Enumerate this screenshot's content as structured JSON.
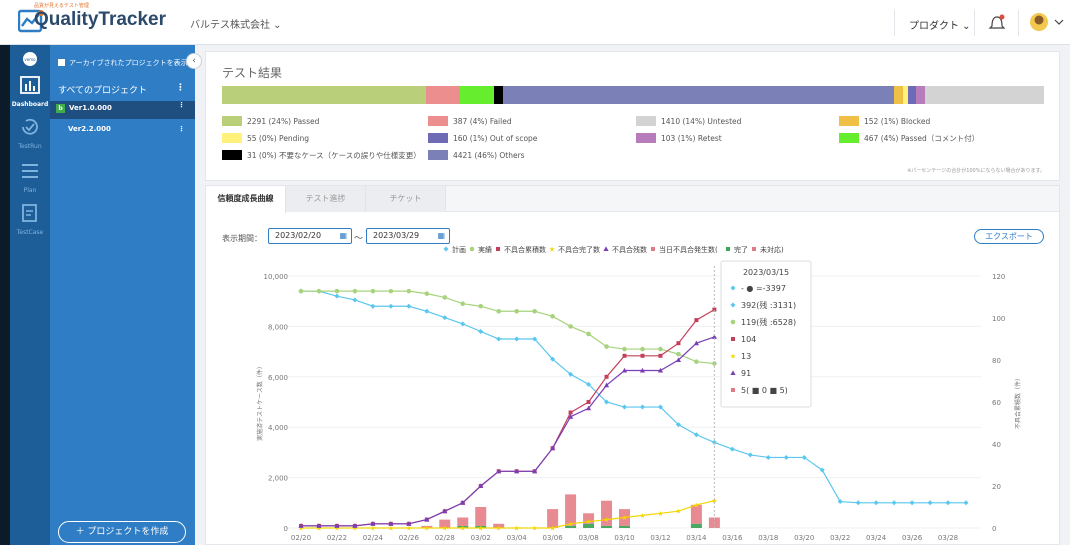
{
  "header": {
    "logo_tagline": "品質が見えるテスト管理",
    "logo_text": "QualityTracker",
    "company": "バルテス株式会社 ⌄",
    "product_menu": "プロダクト ⌄"
  },
  "rail": {
    "items": [
      {
        "label": "Dashboard",
        "icon": "bar-chart-icon",
        "active": true
      },
      {
        "label": "TestRun",
        "icon": "refresh-check-icon",
        "active": false
      },
      {
        "label": "Plan",
        "icon": "list-icon",
        "active": false
      },
      {
        "label": "TestCase",
        "icon": "edit-doc-icon",
        "active": false
      }
    ]
  },
  "sidebar": {
    "archive_toggle": "アーカイブされたプロジェクトを表示",
    "all_projects": "すべてのプロジェクト",
    "projects": [
      {
        "badge": "b",
        "name": "Ver1.0.000",
        "selected": true
      },
      {
        "name": "Ver2.2.000",
        "selected": false
      }
    ],
    "create_button": "＋ プロジェクトを作成"
  },
  "results": {
    "title": "テスト結果",
    "segments": [
      {
        "color": "#b9cf7a",
        "pct": 24
      },
      {
        "color": "#ec8e8e",
        "pct": 4
      },
      {
        "color": "#66ee2e",
        "pct": 4
      },
      {
        "color": "#000000",
        "pct": 1
      },
      {
        "color": "#7b80b7",
        "pct": 46
      },
      {
        "color": "#f0bf45",
        "pct": 1
      },
      {
        "color": "#fff17a",
        "pct": 0.6
      },
      {
        "color": "#6e6ab5",
        "pct": 1
      },
      {
        "color": "#b77cbc",
        "pct": 1
      },
      {
        "color": "#d3d3d3",
        "pct": 14
      }
    ],
    "legend": [
      {
        "label": "2291 (24%) Passed",
        "color": "#b9cf7a"
      },
      {
        "label": "387 (4%) Failed",
        "color": "#ec8e8e"
      },
      {
        "label": "1410 (14%) Untested",
        "color": "#d3d3d3"
      },
      {
        "label": "152 (1%) Blocked",
        "color": "#f0bf45"
      },
      {
        "label": "55 (0%) Pending",
        "color": "#fff17a"
      },
      {
        "label": "160 (1%) Out of scope",
        "color": "#6e6ab5"
      },
      {
        "label": "103 (1%) Retest",
        "color": "#b77cbc"
      },
      {
        "label": "467 (4%) Passed（コメント付）",
        "color": "#66ee2e"
      },
      {
        "label": "31 (0%) 不要なケース（ケースの誤りや仕様変更）",
        "color": "#000000"
      },
      {
        "label": "4421 (46%) Others",
        "color": "#7b80b7"
      }
    ],
    "note": "※パーセンテージの合計が100%にならない場合があります。"
  },
  "chart_panel": {
    "tabs": [
      "信頼度成長曲線",
      "テスト進捗",
      "チケット"
    ],
    "period_label": "表示期間：",
    "date_from": "2023/02/20",
    "date_to": "2023/03/29",
    "tilde": "～",
    "export_button": "エクスポート"
  },
  "chart_data": {
    "type": "line",
    "x": [
      "02/20",
      "02/21",
      "02/22",
      "02/23",
      "02/24",
      "02/25",
      "02/26",
      "02/27",
      "02/28",
      "03/01",
      "03/02",
      "03/03",
      "03/04",
      "03/05",
      "03/06",
      "03/07",
      "03/08",
      "03/09",
      "03/10",
      "03/11",
      "03/12",
      "03/13",
      "03/14",
      "03/15",
      "03/16",
      "03/17",
      "03/18",
      "03/19",
      "03/20",
      "03/21",
      "03/22",
      "03/23",
      "03/24",
      "03/25",
      "03/26",
      "03/27",
      "03/28",
      "03/29"
    ],
    "xticks": [
      "02/20",
      "02/22",
      "02/24",
      "02/26",
      "02/28",
      "03/02",
      "03/04",
      "03/06",
      "03/08",
      "03/10",
      "03/12",
      "03/14",
      "03/16",
      "03/18",
      "03/20",
      "03/22",
      "03/24",
      "03/26",
      "03/28"
    ],
    "ylabel_left": "実施済テストケース数（件）",
    "ylabel_right": "不具合累積数（件）",
    "ylim_left": [
      0,
      10000
    ],
    "ylim_right": [
      0,
      120
    ],
    "yticks_left": [
      "0",
      "2,000",
      "4,000",
      "6,000",
      "8,000",
      "10,000"
    ],
    "yticks_right": [
      "0",
      "20",
      "40",
      "60",
      "80",
      "100",
      "120"
    ],
    "legend": [
      {
        "name": "計画",
        "color": "#5bc6ee",
        "marker": "diamond"
      },
      {
        "name": "実績",
        "color": "#a8d37d",
        "marker": "circle"
      },
      {
        "name": "不具合累積数",
        "color": "#c4405a",
        "marker": "square"
      },
      {
        "name": "不具合完了数",
        "color": "#f2d600",
        "marker": "star"
      },
      {
        "name": "不具合残数",
        "color": "#7a3fb5",
        "marker": "triangle"
      },
      {
        "name": "当日不具合発生数(",
        "color": "#e07b86",
        "marker": "square"
      },
      {
        "name": "完了",
        "color": "#3aa65a",
        "marker": "square"
      },
      {
        "name": "未対応)",
        "color": "#e07b86",
        "marker": "square"
      }
    ],
    "series": [
      {
        "name": "計画",
        "axis": "left",
        "values": [
          9400,
          9400,
          9200,
          9050,
          8800,
          8800,
          8800,
          8600,
          8350,
          8100,
          7800,
          7500,
          7500,
          7500,
          6700,
          6100,
          5700,
          5000,
          4800,
          4800,
          4800,
          4100,
          3700,
          3397,
          3131,
          2900,
          2800,
          2800,
          2800,
          2300,
          1050,
          1000,
          1000,
          1000,
          1000,
          1000,
          1000,
          1000
        ]
      },
      {
        "name": "実績",
        "axis": "left",
        "values": [
          9400,
          9400,
          9400,
          9400,
          9400,
          9400,
          9400,
          9300,
          9150,
          8900,
          8800,
          8600,
          8600,
          8600,
          8400,
          8000,
          7700,
          7200,
          7100,
          7100,
          7100,
          6900,
          6600,
          6528,
          null,
          null,
          null,
          null,
          null,
          null,
          null,
          null,
          null,
          null,
          null,
          null,
          null,
          null
        ]
      },
      {
        "name": "不具合累積数",
        "axis": "right",
        "values": [
          1,
          1,
          1,
          1,
          2,
          2,
          2,
          4,
          8,
          12,
          20,
          27,
          27,
          27,
          38,
          55,
          60,
          72,
          82,
          82,
          82,
          88,
          99,
          104,
          null,
          null,
          null,
          null,
          null,
          null,
          null,
          null,
          null,
          null,
          null,
          null,
          null,
          null
        ]
      },
      {
        "name": "不具合完了数",
        "axis": "right",
        "values": [
          0,
          0,
          0,
          0,
          0,
          0,
          0,
          0,
          0,
          0,
          0,
          0,
          0,
          0,
          0,
          2,
          3,
          4,
          5,
          6,
          7,
          8,
          11,
          13,
          null,
          null,
          null,
          null,
          null,
          null,
          null,
          null,
          null,
          null,
          null,
          null,
          null,
          null
        ]
      },
      {
        "name": "不具合残数",
        "axis": "right",
        "values": [
          1,
          1,
          1,
          1,
          2,
          2,
          2,
          4,
          8,
          12,
          20,
          27,
          27,
          27,
          38,
          53,
          57,
          68,
          75,
          75,
          75,
          80,
          88,
          91,
          null,
          null,
          null,
          null,
          null,
          null,
          null,
          null,
          null,
          null,
          null,
          null,
          null,
          null
        ]
      },
      {
        "name": "完了",
        "axis": "right",
        "type": "bar",
        "values": [
          0,
          0,
          0,
          0,
          0,
          0,
          0,
          0,
          0,
          1,
          1,
          0,
          0,
          0,
          0,
          1,
          2,
          1,
          1,
          0,
          0,
          0,
          2,
          0,
          null,
          null,
          null,
          null,
          null,
          null,
          null,
          null,
          null,
          null,
          null,
          null,
          null,
          null
        ]
      },
      {
        "name": "未対応",
        "axis": "right",
        "type": "bar",
        "values": [
          0,
          0,
          0,
          0,
          0,
          0,
          0,
          1,
          4,
          4,
          9,
          2,
          0,
          0,
          9,
          15,
          5,
          12,
          8,
          0,
          0,
          0,
          9,
          5,
          null,
          null,
          null,
          null,
          null,
          null,
          null,
          null,
          null,
          null,
          null,
          null,
          null,
          null
        ]
      }
    ],
    "tooltip": {
      "date": "2023/03/15",
      "lines": [
        {
          "text": "- ● =-3397",
          "color": "#5bc6ee"
        },
        {
          "text": "392(残 :3131)",
          "color": "#5bc6ee"
        },
        {
          "text": "119(残 :6528)",
          "color": "#a8d37d"
        },
        {
          "text": "104",
          "color": "#c4405a"
        },
        {
          "text": "13",
          "color": "#f2d600"
        },
        {
          "text": "91",
          "color": "#7a3fb5"
        },
        {
          "text": "5( ■ 0 ■ 5)",
          "color": "#e07b86"
        }
      ]
    }
  }
}
